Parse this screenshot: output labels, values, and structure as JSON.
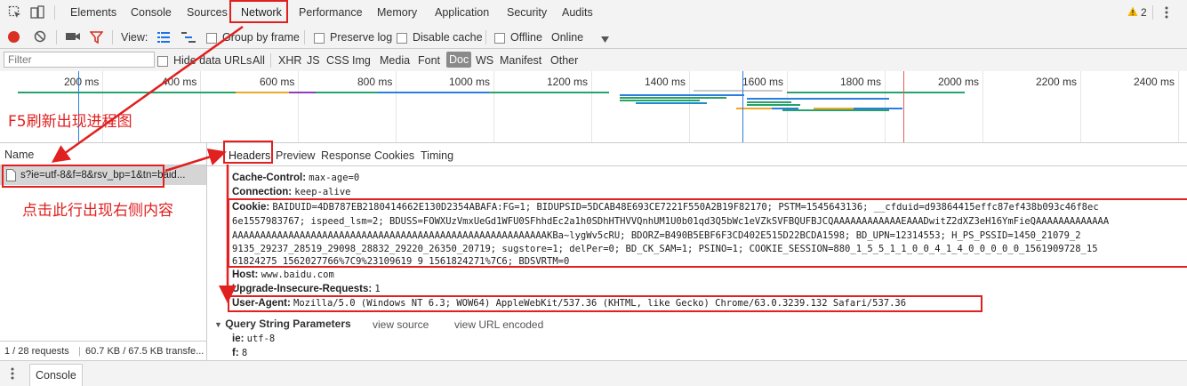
{
  "tabs": [
    "Elements",
    "Console",
    "Sources",
    "Network",
    "Performance",
    "Memory",
    "Application",
    "Security",
    "Audits"
  ],
  "warnings": "2",
  "toolbar": {
    "view_label": "View:",
    "group_by_frame": "Group by frame",
    "preserve_log": "Preserve log",
    "disable_cache": "Disable cache",
    "offline": "Offline",
    "online": "Online"
  },
  "filter": {
    "placeholder": "Filter",
    "hide_data_urls": "Hide data URLs",
    "types": [
      "All",
      "XHR",
      "JS",
      "CSS",
      "Img",
      "Media",
      "Font",
      "Doc",
      "WS",
      "Manifest",
      "Other"
    ],
    "active_type": "Doc"
  },
  "timeline": {
    "ticks": [
      "200 ms",
      "400 ms",
      "600 ms",
      "800 ms",
      "1000 ms",
      "1200 ms",
      "1400 ms",
      "1600 ms",
      "1800 ms",
      "2000 ms",
      "2200 ms",
      "2400 ms"
    ]
  },
  "request_list": {
    "name_header": "Name",
    "row_name": "s?ie=utf-8&f=8&rsv_bp=1&tn=baid...",
    "summary_requests": "1 / 28 requests",
    "summary_size": "60.7 KB / 67.5 KB transfe..."
  },
  "details": {
    "tabs": [
      "Headers",
      "Preview",
      "Response",
      "Cookies",
      "Timing"
    ],
    "headers": {
      "cache_control_key": "Cache-Control:",
      "cache_control_val": "max-age=0",
      "connection_key": "Connection:",
      "connection_val": "keep-alive",
      "cookie_key": "Cookie:",
      "cookie_lines": [
        "BAIDUID=4DB787EB2180414662E130D2354ABAFA:FG=1; BIDUPSID=5DCAB48E693CE7221F550A2B19F82170; PSTM=1545643136; __cfduid=d93864415effc87ef438b093c46f8ec",
        "6e1557983767; ispeed_lsm=2; BDUSS=FOWXUzVmxUeGd1WFU0SFhhdEc2a1h0SDhHTHVVQnhUM1U0b01qd3Q5bWc1eVZkSVFBQUFBJCQAAAAAAAAAAAAEAAADwitZ2dXZ3eH16YmFieQAAAAAAAAAAAAA",
        "AAAAAAAAAAAAAAAAAAAAAAAAAAAAAAAAAAAAAAAAAAAAAAAAAAAAAAAAKBa~lygWv5cRU; BDORZ=B490B5EBF6F3CD402E515D22BCDA1598; BD_UPN=12314553; H_PS_PSSID=1450_21079_2",
        "9135_29237_28519_29098_28832_29220_26350_20719; sugstore=1; delPer=0; BD_CK_SAM=1; PSINO=1; COOKIE_SESSION=880_1_5_5_1_1_0_0_4_1_4_0_0_0_0_0_1561909728_15",
        "61824275_1562027766%7C9%23109619_9_1561824271%7C6; BDSVRTM=0"
      ],
      "host_key": "Host:",
      "host_val": "www.baidu.com",
      "uir_key": "Upgrade-Insecure-Requests:",
      "uir_val": "1",
      "ua_key": "User-Agent:",
      "ua_val": "Mozilla/5.0 (Windows NT 6.3; WOW64) AppleWebKit/537.36 (KHTML, like Gecko) Chrome/63.0.3239.132 Safari/537.36"
    },
    "query_section": "Query String Parameters",
    "view_source": "view source",
    "view_url_encoded": "view URL encoded",
    "params": [
      {
        "key": "ie:",
        "val": "utf-8"
      },
      {
        "key": "f:",
        "val": "8"
      }
    ]
  },
  "annotations": {
    "timeline_note": "F5刷新出现进程图",
    "row_note": "点击此行出现右侧内容"
  },
  "drawer": {
    "console_tab": "Console"
  },
  "colors": {
    "annotation_red": "#e12020",
    "record_red": "#d93025",
    "accent_blue": "#1a73e8"
  }
}
